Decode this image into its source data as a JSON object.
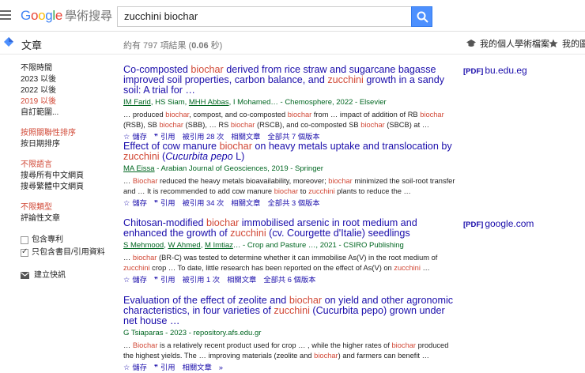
{
  "header": {
    "logo": {
      "g": "G",
      "o1": "o",
      "o2": "o",
      "g2": "g",
      "l": "l",
      "e": "e",
      "scholar": "學術搜尋"
    },
    "search_value": "zucchini biochar"
  },
  "subbar": {
    "title": "文章",
    "count_prefix": "約有 797 項結果 (",
    "count_time": "0.06",
    "count_suffix": " 秒)",
    "my_profile": "我的個人學術檔案",
    "my_library": "我的圖書"
  },
  "sidebar": {
    "time": [
      "不限時間",
      "2023 以後",
      "2022 以後",
      "2019 以後",
      "自訂範圍..."
    ],
    "sort": [
      "按照關聯性排序",
      "按日期排序"
    ],
    "lang": [
      "不限語言",
      "搜尋所有中文網頁",
      "搜尋繁體中文網頁"
    ],
    "type": [
      "不限類型",
      "評論性文章"
    ],
    "patents": "包含專利",
    "citations": "只包含書目/引用資料",
    "alert": "建立快訊"
  },
  "results": [
    {
      "title": [
        {
          "t": "Co-composted ",
          "h": false
        },
        {
          "t": "biochar",
          "h": true
        },
        {
          "t": " derived from rice straw and sugarcane bagasse improved soil properties, carbon balance, and ",
          "h": false
        },
        {
          "t": "zucchini",
          "h": true
        },
        {
          "t": " growth in a sandy soil: A trial for …",
          "h": false
        }
      ],
      "authors": [
        {
          "t": "IM Farid",
          "u": true
        },
        {
          "t": ", HS Siam, ",
          "u": false
        },
        {
          "t": "MHH Abbas",
          "u": true
        },
        {
          "t": ", I Mohamed… - Chemosphere, 2022 - Elsevier",
          "u": false
        }
      ],
      "snippet": [
        {
          "t": "… produced ",
          "h": false
        },
        {
          "t": "biochar",
          "h": true
        },
        {
          "t": ", compost, and co-composted ",
          "h": false
        },
        {
          "t": "biochar",
          "h": true
        },
        {
          "t": " from … impact of addition of RB ",
          "h": false
        },
        {
          "t": "biochar",
          "h": true
        },
        {
          "t": " (RSB), SB ",
          "h": false
        },
        {
          "t": "biochar",
          "h": true
        },
        {
          "t": " (SBB), … RS ",
          "h": false
        },
        {
          "t": "biochar",
          "h": true
        },
        {
          "t": " (RSCB), and co-composted SB ",
          "h": false
        },
        {
          "t": "biochar",
          "h": true
        },
        {
          "t": " (SBCB) at …",
          "h": false
        }
      ],
      "actions": [
        "儲存",
        "引用",
        "被引用 28 次",
        "相關文章",
        "全部共 7 個版本"
      ],
      "pdf": {
        "tag": "[PDF]",
        "domain": "bu.edu.eg"
      }
    },
    {
      "title": [
        {
          "t": "Effect of cow manure ",
          "h": false
        },
        {
          "t": "biochar",
          "h": true
        },
        {
          "t": " on heavy metals uptake and translocation by ",
          "h": false
        },
        {
          "t": "zucchini",
          "h": true
        },
        {
          "t": " (Cucurbita pepo L)",
          "h": false
        }
      ],
      "authors": [
        {
          "t": "MA Eissa",
          "u": true
        },
        {
          "t": " - Arabian Journal of Geosciences, 2019 - Springer",
          "u": false
        }
      ],
      "snippet": [
        {
          "t": "… ",
          "h": false
        },
        {
          "t": "Biochar",
          "h": true
        },
        {
          "t": " reduced the heavy metals bioavailability, moreover; ",
          "h": false
        },
        {
          "t": "biochar",
          "h": true
        },
        {
          "t": " minimized the soil-root transfer and … It is recommended to add cow manure ",
          "h": false
        },
        {
          "t": "biochar",
          "h": true
        },
        {
          "t": " to ",
          "h": false
        },
        {
          "t": "zucchini",
          "h": true
        },
        {
          "t": " plants to reduce the …",
          "h": false
        }
      ],
      "actions": [
        "儲存",
        "引用",
        "被引用 34 次",
        "相關文章",
        "全部共 3 個版本"
      ],
      "pdf": null
    },
    {
      "title": [
        {
          "t": "Chitosan-modified ",
          "h": false
        },
        {
          "t": "biochar",
          "h": true
        },
        {
          "t": " immobilised arsenic in root medium and enhanced the growth of ",
          "h": false
        },
        {
          "t": "zucchini",
          "h": true
        },
        {
          "t": " (cv. Courgette d'Italie) seedlings",
          "h": false
        }
      ],
      "authors": [
        {
          "t": "S Mehmood",
          "u": true
        },
        {
          "t": ", ",
          "u": false
        },
        {
          "t": "W Ahmed",
          "u": true
        },
        {
          "t": ", ",
          "u": false
        },
        {
          "t": "M Imtiaz",
          "u": true
        },
        {
          "t": "… - Crop and Pasture …, 2021 - CSIRO Publishing",
          "u": false
        }
      ],
      "snippet": [
        {
          "t": "… ",
          "h": false
        },
        {
          "t": "biochar",
          "h": true
        },
        {
          "t": " (BR-C) was tested to determine whether it can immobilise As(V) in the root medium of ",
          "h": false
        },
        {
          "t": "zucchini",
          "h": true
        },
        {
          "t": " crop … To date, little research has been reported on the effect of As(V) on ",
          "h": false
        },
        {
          "t": "zucchini",
          "h": true
        },
        {
          "t": " …",
          "h": false
        }
      ],
      "actions": [
        "儲存",
        "引用",
        "被引用 1 次",
        "相關文章",
        "全部共 6 個版本"
      ],
      "pdf": {
        "tag": "[PDF]",
        "domain": "google.com"
      }
    },
    {
      "title": [
        {
          "t": "Evaluation of the effect of zeolite and ",
          "h": false
        },
        {
          "t": "biochar",
          "h": true
        },
        {
          "t": " on yield and other agronomic characteristics, in four varieties of ",
          "h": false
        },
        {
          "t": "zucchini",
          "h": true
        },
        {
          "t": " (Cucurbita pepo) grown under net house …",
          "h": false
        }
      ],
      "authors": [
        {
          "t": "G Tsiaparas - 2023 - repository.afs.edu.gr",
          "u": false
        }
      ],
      "snippet": [
        {
          "t": "… ",
          "h": false
        },
        {
          "t": "Biochar",
          "h": true
        },
        {
          "t": " is a relatively recent product used for crop … , while the higher rates of ",
          "h": false
        },
        {
          "t": "biochar",
          "h": true
        },
        {
          "t": " produced the highest yields. The … improving materials (zeolite and ",
          "h": false
        },
        {
          "t": "biochar",
          "h": true
        },
        {
          "t": ") and farmers can benefit …",
          "h": false
        }
      ],
      "actions": [
        "儲存",
        "引用",
        "相關文章"
      ],
      "pdf": null
    }
  ]
}
